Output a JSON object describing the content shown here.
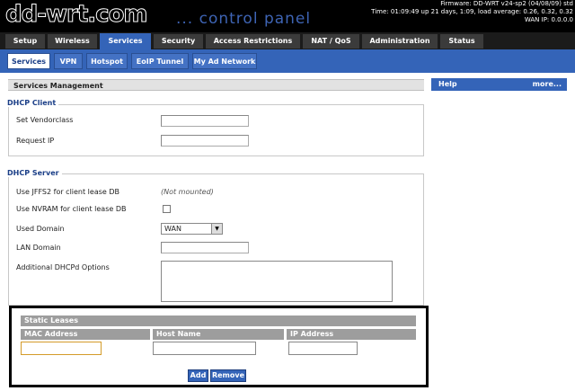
{
  "header": {
    "logo": "dd-wrt.com",
    "control_panel": "... control panel",
    "firmware": "Firmware: DD-WRT v24-sp2 (04/08/09) std",
    "time": "Time: 01:09:49 up 21 days, 1:09, load average: 0.26, 0.32, 0.32",
    "wan_ip": "WAN IP: 0.0.0.0"
  },
  "main_tabs": [
    "Setup",
    "Wireless",
    "Services",
    "Security",
    "Access Restrictions",
    "NAT / QoS",
    "Administration",
    "Status"
  ],
  "sub_tabs": [
    "Services",
    "VPN",
    "Hotspot",
    "EoIP Tunnel",
    "My Ad Network"
  ],
  "section_title": "Services Management",
  "help": {
    "title": "Help",
    "more": "more..."
  },
  "dhcp_client": {
    "legend": "DHCP Client",
    "vendorclass_label": "Set Vendorclass",
    "request_ip_label": "Request IP"
  },
  "dhcp_server": {
    "legend": "DHCP Server",
    "jffs2_label": "Use JFFS2 for client lease DB",
    "jffs2_note": "(Not mounted)",
    "nvram_label": "Use NVRAM for client lease DB",
    "used_domain_label": "Used Domain",
    "used_domain_value": "WAN",
    "lan_domain_label": "LAN Domain",
    "additional_options_label": "Additional DHCPd Options"
  },
  "static_leases": {
    "title": "Static Leases",
    "columns": [
      "MAC Address",
      "Host Name",
      "IP Address"
    ],
    "add_label": "Add",
    "remove_label": "Remove"
  },
  "colors": {
    "accent": "#3464b8",
    "header_bg": "#000000",
    "lease_header": "#9d9d9d"
  }
}
